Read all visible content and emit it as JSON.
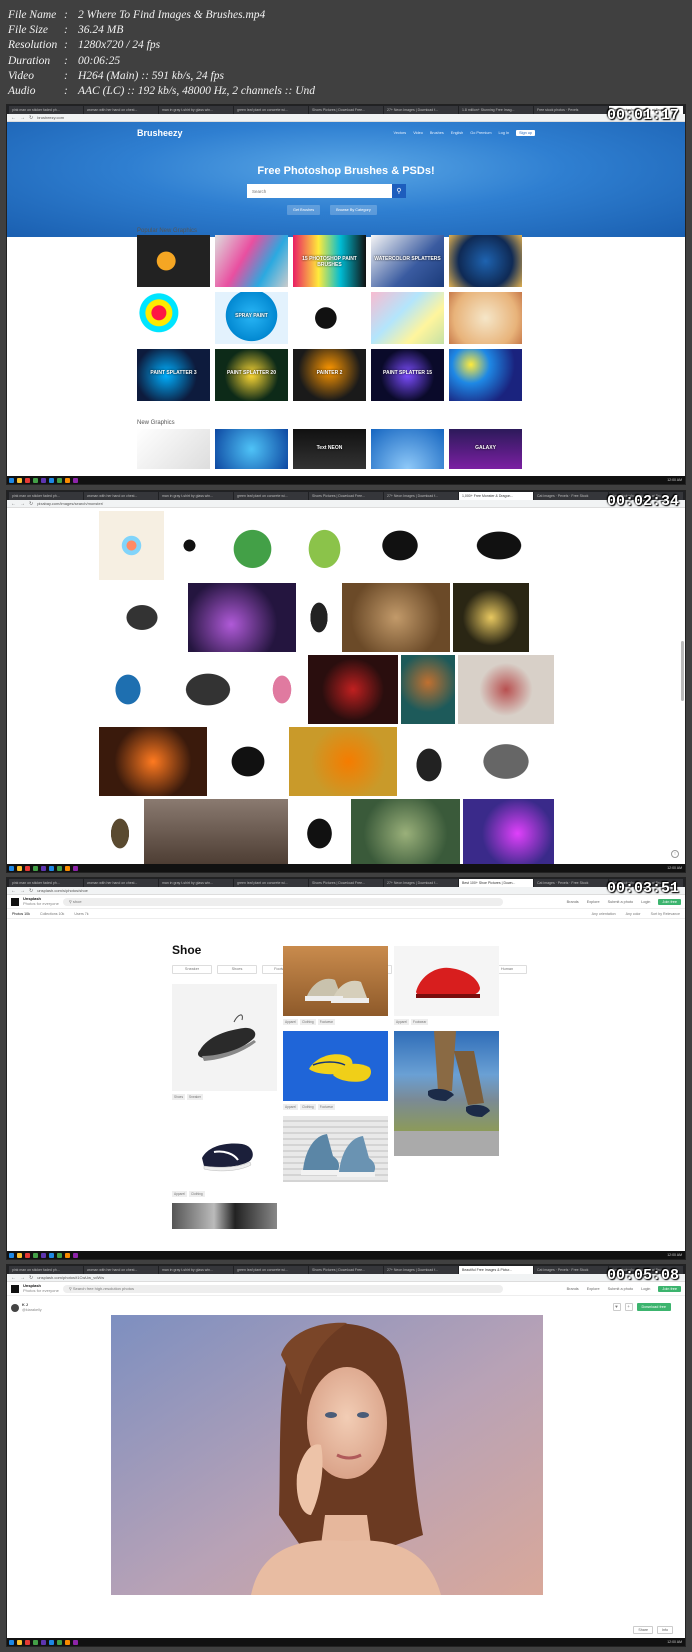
{
  "media_info": [
    {
      "key": "File Name",
      "value": "2 Where To Find Images & Brushes.mp4"
    },
    {
      "key": "File Size",
      "value": "36.24 MB"
    },
    {
      "key": "Resolution",
      "value": "1280x720 / 24 fps"
    },
    {
      "key": "Duration",
      "value": "00:06:25"
    },
    {
      "key": "Video",
      "value": "H264 (Main) :: 591 kb/s, 24 fps"
    },
    {
      "key": "Audio",
      "value": "AAC (LC) :: 192 kb/s, 48000 Hz, 2 channels :: Und"
    }
  ],
  "frames": [
    {
      "timestamp": "00:01:17",
      "url": "brusheezy.com",
      "brusheezy": {
        "logo": "Brusheezy",
        "nav_links": [
          "Vectors",
          "Video",
          "Brushes",
          "English",
          "Go Premium",
          "Log In"
        ],
        "signup": "Sign up",
        "hero_title": "Free Photoshop Brushes & PSDs!",
        "search_placeholder": "Search",
        "pills": [
          "Get Brushes",
          "Browse By Category"
        ],
        "popular_label": "Popular New Graphics",
        "new_label": "New Graphics",
        "thumb_captions": [
          "",
          "",
          "15 PHOTOSHOP PAINT BRUSHES",
          "WATERCOLOR SPLATTERS",
          "",
          "",
          "SPRAY PAINT",
          "",
          "",
          "",
          "PAINT SPLATTER 3",
          "PAINT SPLATTER 20",
          "PAINTER 2",
          "PAINT SPLATTER 15",
          ""
        ],
        "new_captions": [
          "",
          "",
          "Text NEON",
          "",
          "GALAXY"
        ]
      }
    },
    {
      "timestamp": "00:02:34",
      "url": "pixabay.com/images/search/monster/"
    },
    {
      "timestamp": "00:03:51",
      "url": "unsplash.com/s/photos/shoe",
      "unsplash": {
        "logo_top": "Unsplash",
        "logo_bottom": "Photos for everyone",
        "search_value": "shoe",
        "right_links": [
          "Brands",
          "Explore",
          "Submit a photo",
          "Login"
        ],
        "join": "Join free",
        "sub_tabs": [
          "Photos 10k",
          "Collections 10k",
          "Users 7k"
        ],
        "sub_right": [
          "Any orientation",
          "Any color",
          "Sort by Relevance"
        ],
        "title": "Shoe",
        "chips": [
          "Sneaker",
          "Shoes",
          "Footwear",
          "Nike",
          "Clothing",
          "Apparel",
          "Person",
          "Human"
        ],
        "tags_a": [
          "Shoes",
          "Sneaker"
        ],
        "tags_b": [
          "Apparel",
          "Clothing",
          "Footwear"
        ],
        "tags_c": [
          "Apparel",
          "Footwear"
        ],
        "tags_d": [
          "Apparel",
          "Clothing"
        ],
        "tags_e": [
          "Apparel",
          "Clothing",
          "Footwear"
        ]
      }
    },
    {
      "timestamp": "00:05:08",
      "url": "unsplash.com/photos/t1CwUw_vdWw",
      "unsplash": {
        "logo_top": "Unsplash",
        "logo_bottom": "Photos for everyone",
        "search_placeholder": "Search free high-resolution photos",
        "right_links": [
          "Brands",
          "Explore",
          "Submit a photo",
          "Login"
        ],
        "join": "Join free",
        "user_name": "K J",
        "user_handle": "@kiarakelly",
        "download": "Download free",
        "share": "Share",
        "info": "Info"
      }
    }
  ],
  "tabs_f1": [
    "pink man on sticker faded ph...",
    "woman with her hand on chest...",
    "man in gray t-shirt by glass win...",
    "green leaf plant on concrete wi...",
    "Shoes Pictures | Download Free...",
    "27+ Neon Images | Download f...",
    "1.8 million+ Stunning Free Imag...",
    "Free stock photos · Pexels",
    "Free Photoshop Brushes at Brus..."
  ],
  "tabs_f2": [
    "pink man on sticker faded ph...",
    "woman with her hand on chest...",
    "man in gray t-shirt by glass win...",
    "green leaf plant on concrete wi...",
    "Shoes Pictures | Download Free...",
    "27+ Neon Images | Download f...",
    "1,000+ Free Monster & Dragon...",
    "Cat images · Pexels · Free Stock",
    "Free Photoshop Brushes at Brus..."
  ],
  "tabs_f3": [
    "pink man on sticker faded ph...",
    "woman with her hand on chest...",
    "man in gray t-shirt by glass win...",
    "green leaf plant on concrete wi...",
    "Shoes Pictures | Download Free...",
    "27+ Neon Images | Download f...",
    "Best 100+ Shoe Pictures | Down...",
    "Cat images · Pexels · Free Stock",
    "Free Photoshop Brushes at Brus..."
  ],
  "tabs_f4": [
    "pink man on sticker faded ph...",
    "woman with her hand on chest...",
    "man in gray t-shirt by glass win...",
    "green leaf plant on concrete wi...",
    "Shoes Pictures | Download Free...",
    "27+ Neon Images | Download f...",
    "Beautiful Free Images & Pictur...",
    "Cat images · Pexels · Free Stock",
    "Free Photoshop Brushes at Brus..."
  ],
  "clock": "12:00 AM",
  "colors": {
    "accent_green": "#3cb46e",
    "brusheezy_blue": "#2f7fd1"
  }
}
